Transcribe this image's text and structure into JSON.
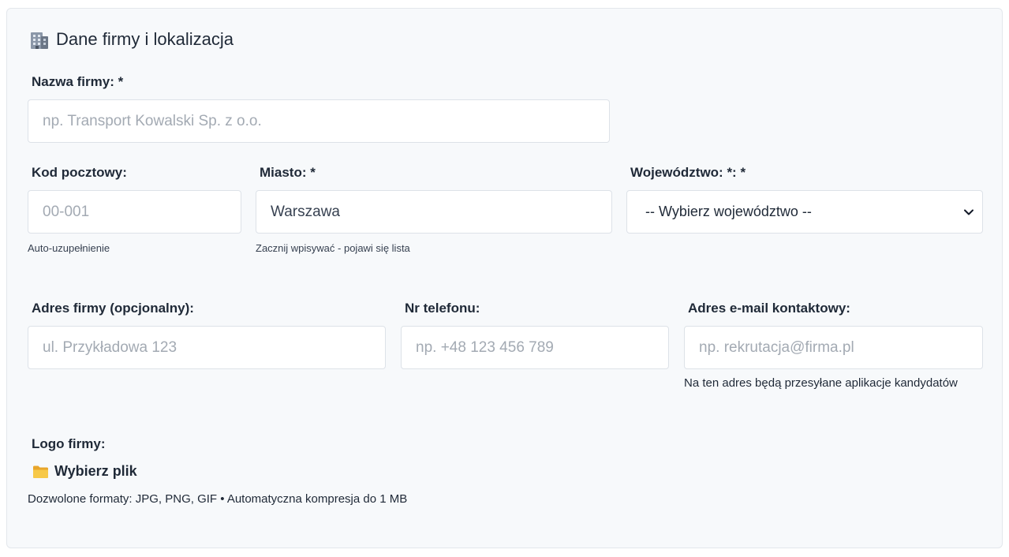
{
  "section": {
    "title": "Dane firmy i lokalizacja",
    "icon": "building-icon"
  },
  "company_name": {
    "label": "Nazwa firmy: *",
    "value": "",
    "placeholder": "np. Transport Kowalski Sp. z o.o."
  },
  "postal_code": {
    "label": "Kod pocztowy:",
    "value": "",
    "placeholder": "00-001",
    "hint": "Auto-uzupełnienie"
  },
  "city": {
    "label": "Miasto: *",
    "value": "Warszawa",
    "hint": "Zacznij wpisywać - pojawi się lista"
  },
  "voivodeship": {
    "label": "Województwo: *: *",
    "selected": "-- Wybierz województwo --",
    "icon": "chevron-down-icon"
  },
  "address": {
    "label": "Adres firmy (opcjonalny):",
    "value": "",
    "placeholder": "ul. Przykładowa 123"
  },
  "phone": {
    "label": "Nr telefonu:",
    "value": "",
    "placeholder": "np. +48 123 456 789"
  },
  "email": {
    "label": "Adres e-mail kontaktowy:",
    "value": "",
    "placeholder": "np. rekrutacja@firma.pl",
    "hint": "Na ten adres będą przesyłane aplikacje kandydatów"
  },
  "logo": {
    "label": "Logo firmy:",
    "button_label": "Wybierz plik",
    "icon": "folder-icon",
    "hint": "Dozwolone formaty: JPG, PNG, GIF • Automatyczna kompresja do 1 MB"
  },
  "colors": {
    "background": "#f7f9fb",
    "border": "#dde2e8",
    "text": "#1f2937",
    "placeholder": "#a3aab3"
  }
}
